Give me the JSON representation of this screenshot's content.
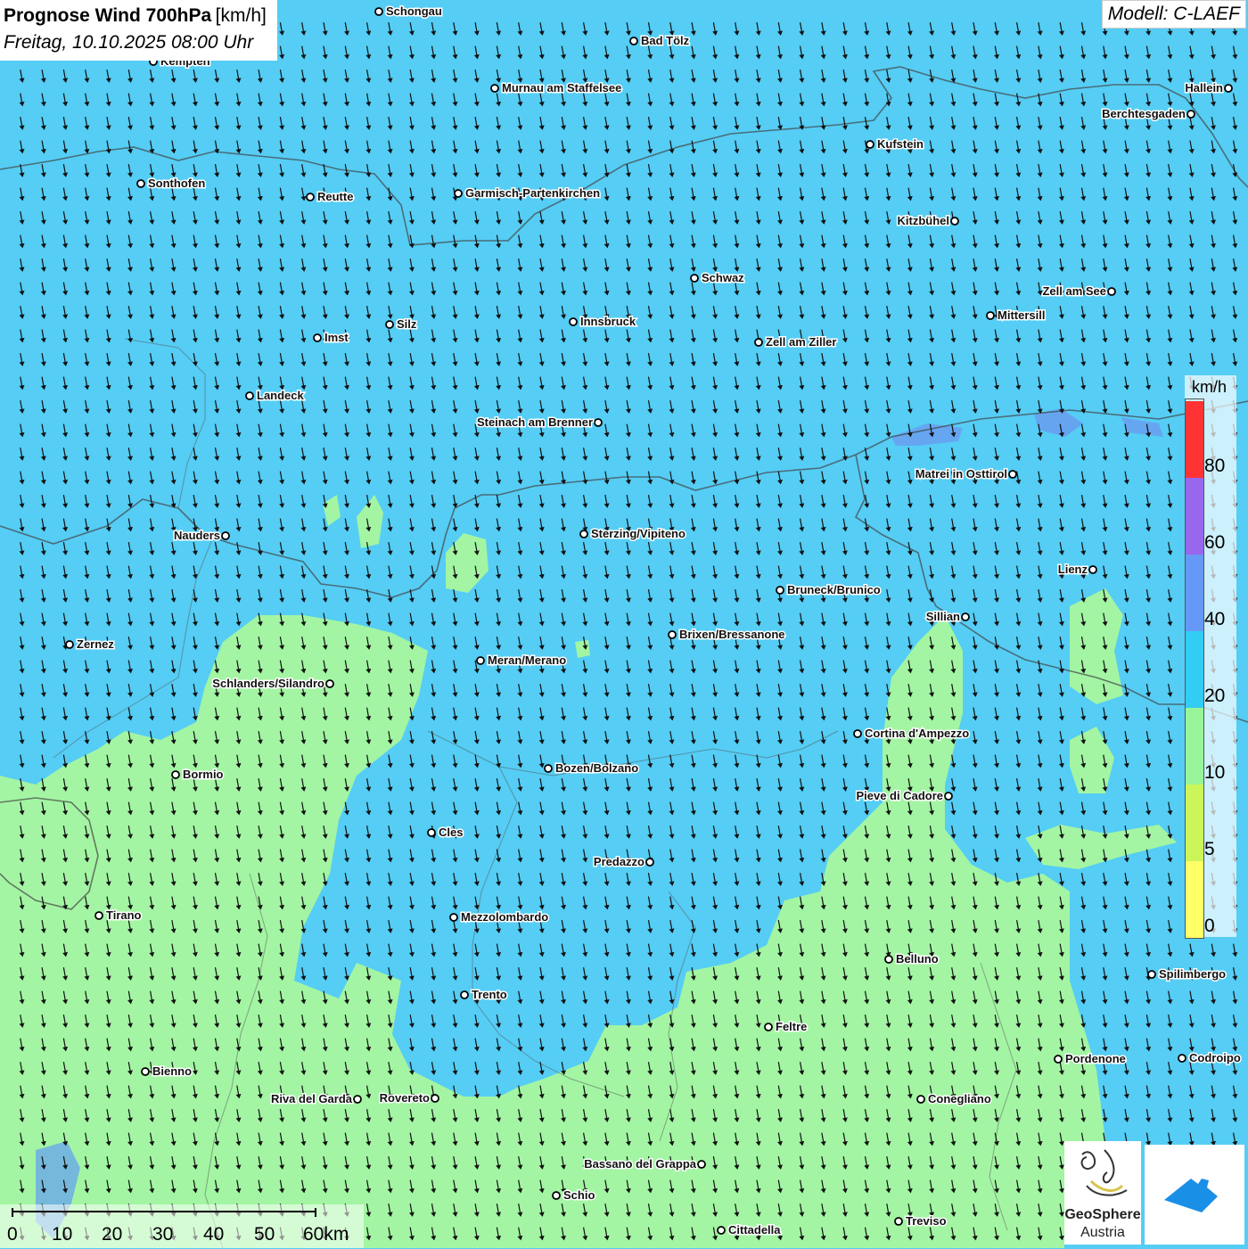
{
  "title": {
    "main": "Prognose Wind 700hPa",
    "unit": "[km/h]",
    "subtitle": "Freitag, 10.10.2025 08:00 Uhr"
  },
  "model": "Modell: C-LAEF",
  "legend": {
    "unit": "km/h",
    "classes": [
      {
        "label": "0",
        "color": "#ffff66"
      },
      {
        "label": "5",
        "color": "#ccf55a"
      },
      {
        "label": "10",
        "color": "#99f599"
      },
      {
        "label": "20",
        "color": "#33ccf5"
      },
      {
        "label": "40",
        "color": "#6699f5"
      },
      {
        "label": "60",
        "color": "#9966ee"
      },
      {
        "label": "80",
        "color": "#ff3333"
      }
    ]
  },
  "scale_bar": {
    "labels": [
      "0",
      "10",
      "20",
      "30",
      "40",
      "50",
      "60km"
    ]
  },
  "logos": {
    "geosphere_line1": "GeoSphere",
    "geosphere_line2": "Austria"
  },
  "cities": [
    "Schongau",
    "Bad Tölz",
    "Kempten",
    "Murnau am Staffelsee",
    "Hallein",
    "Berchtesgaden",
    "Kufstein",
    "Sonthofen",
    "Reutte",
    "Garmisch-Partenkirchen",
    "Kitzbühel",
    "Schwaz",
    "Zell am See",
    "Mittersill",
    "Innsbruck",
    "Silz",
    "Imst",
    "Zell am Ziller",
    "Landeck",
    "Steinach am Brenner",
    "Matrei in Osttirol",
    "Nauders",
    "Sterzing/Vipiteno",
    "Lienz",
    "Bruneck/Brunico",
    "Sillian",
    "Zernez",
    "Brixen/Bressanone",
    "Meran/Merano",
    "Schlanders/Silandro",
    "Cortina d'Ampezzo",
    "Bormio",
    "Bozen/Bolzano",
    "Pieve di Cadore",
    "Cles",
    "Predazzo",
    "Tirano",
    "Mezzolombardo",
    "Belluno",
    "Spilimbergo",
    "Trento",
    "Feltre",
    "Pordenone",
    "Codroipo",
    "Bienno",
    "Riva del Garda",
    "Rovereto",
    "Conegliano",
    "Bassano del Grappa",
    "Schio",
    "Treviso",
    "Cittadella"
  ],
  "wind": {
    "direction_shown": "from north (arrows point south)",
    "dominant_class": "10-20 km/h",
    "southern_class": "5-10 km/h"
  }
}
